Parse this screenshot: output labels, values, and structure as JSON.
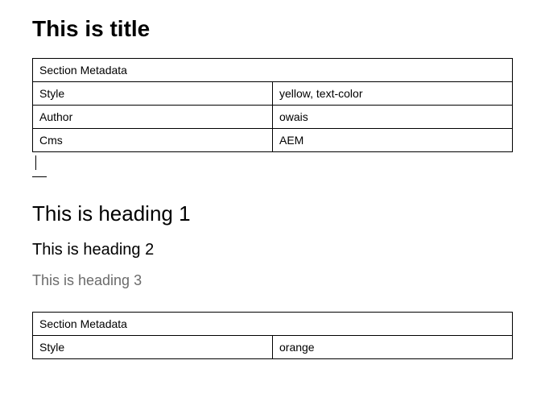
{
  "title": "This is title",
  "table1": {
    "header": "Section Metadata",
    "rows": [
      {
        "key": "Style",
        "value": "yellow, text-color"
      },
      {
        "key": "Author",
        "value": "owais"
      },
      {
        "key": "Cms",
        "value": "AEM"
      }
    ]
  },
  "heading1": "This is heading 1",
  "heading2": "This is heading 2",
  "heading3": "This is heading 3",
  "table2": {
    "header": "Section Metadata",
    "rows": [
      {
        "key": "Style",
        "value": "orange"
      }
    ]
  }
}
